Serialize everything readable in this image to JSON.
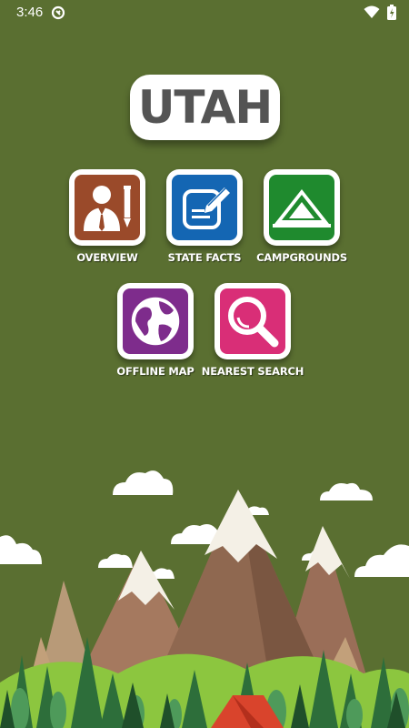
{
  "status_bar": {
    "time": "3:46"
  },
  "app": {
    "title": "UTAH"
  },
  "menu": {
    "overview": "OVERVIEW",
    "state_facts": "STATE FACTS",
    "campgrounds": "CAMPGROUNDS",
    "offline_map": "OFFLINE MAP",
    "nearest_search": "NEAREST SEARCH"
  },
  "colors": {
    "background": "#5a6f31",
    "overview": "#9a4a2a",
    "state_facts": "#1466b3",
    "campgrounds": "#1f8a2e",
    "offline_map": "#7e2c8c",
    "nearest_search": "#d92e77"
  },
  "icons": {
    "overview": "businessman-pencil-icon",
    "state_facts": "notepad-pencil-icon",
    "campgrounds": "tent-icon",
    "offline_map": "globe-icon",
    "nearest_search": "magnifier-icon"
  }
}
